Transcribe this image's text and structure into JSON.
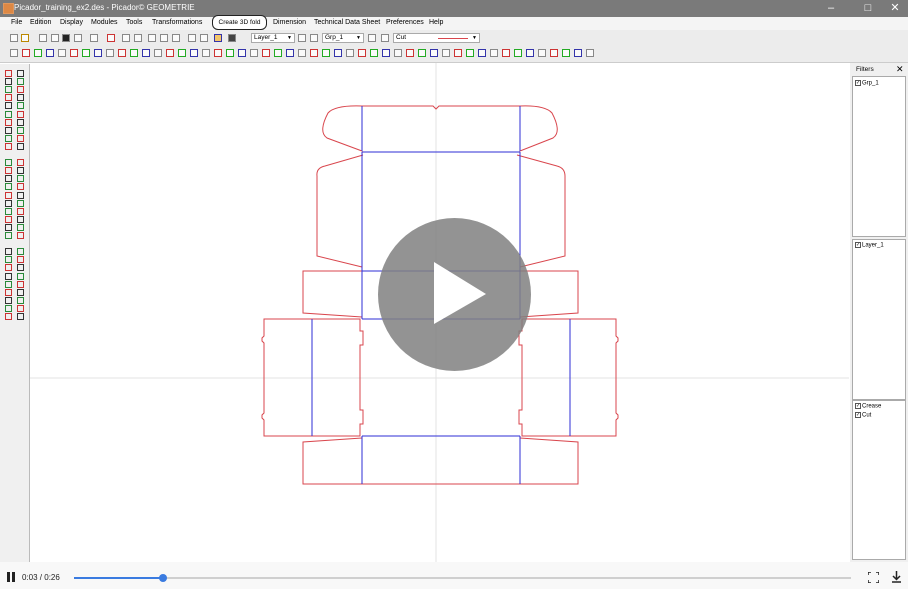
{
  "window": {
    "title": "Picador_training_ex2.des - Picador© GEOMETRIE"
  },
  "menu": [
    "File",
    "Edition",
    "Display",
    "Modules",
    "Tools",
    "Transformations",
    "",
    "Dimension",
    "Technical Data Sheet",
    "Preferences",
    "Help"
  ],
  "tooltip": "Create 3D fold",
  "toolbar": {
    "layer_value": "Layer_1",
    "group_value": "Grp_1",
    "linetype_value": "Cut"
  },
  "filters": {
    "title": "Filters",
    "groups": [
      {
        "label": "Grp_1",
        "checked": true
      }
    ],
    "layers": [
      {
        "label": "Layer_1",
        "checked": true
      }
    ],
    "types": [
      {
        "label": "Crease",
        "checked": true
      },
      {
        "label": "Cut",
        "checked": true
      }
    ]
  },
  "colors": {
    "cut_line": "#d9464d",
    "crease_line": "#2e2ed6",
    "progress": "#3a7be0"
  },
  "video": {
    "current_time": "0:03",
    "duration": "0:26",
    "time_display": "0:03 / 0:26",
    "progress_fraction": 0.115,
    "state": "playing"
  }
}
